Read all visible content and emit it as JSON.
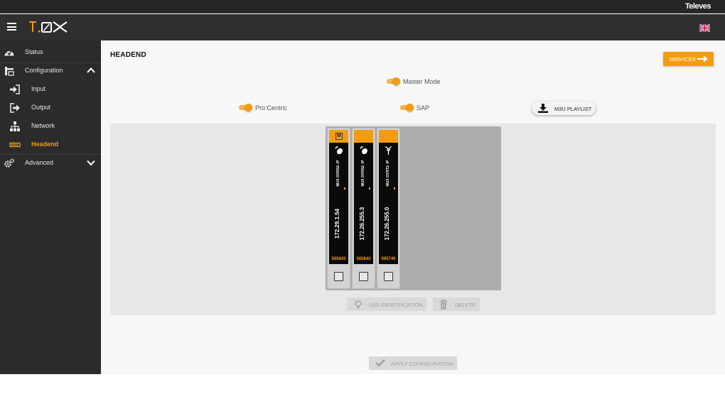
{
  "header": {
    "brand": "Televes",
    "logo_text": "T.OX",
    "language_icon": "uk-flag-icon"
  },
  "sidebar": {
    "items": [
      {
        "label": "Status",
        "icon": "dashboard-icon",
        "active": false
      },
      {
        "label": "Configuration",
        "icon": "configuration-icon",
        "expanded": true
      },
      {
        "label": "Input",
        "icon": "sign-in-icon",
        "active": false
      },
      {
        "label": "Output",
        "icon": "sign-out-icon",
        "active": false
      },
      {
        "label": "Network",
        "icon": "network-icon",
        "active": false
      },
      {
        "label": "Headend",
        "icon": "headend-icon",
        "active": true
      },
      {
        "label": "Advanced",
        "icon": "cogs-icon",
        "expanded": false
      }
    ]
  },
  "main": {
    "title": "HEADEND",
    "services_label": "SERVICES",
    "master_mode": {
      "label": "Master Mode",
      "on": true
    },
    "pro_centric": {
      "label": "Pro:Centric",
      "on": true
    },
    "sap": {
      "label": "SAP",
      "on": true
    },
    "m3u_label": "M3U PLAYLIST",
    "led_label": "LED IDENTIFICATION",
    "delete_label": "DELETE",
    "apply_label": "APPLY CONFIGURATION",
    "modules": [
      {
        "badge": "M",
        "icon": "satellite-dish-icon",
        "model": "MUX OVRS2- IP",
        "ip": "172.29.1.54",
        "serial": "565843"
      },
      {
        "badge": "",
        "icon": "satellite-dish-icon",
        "model": "MUX OVRS2- IP",
        "ip": "172.26.255.3",
        "serial": "565843"
      },
      {
        "badge": "",
        "icon": "antenna-icon",
        "model": "MUX OVRT2- IP",
        "ip": "172.26.255.0",
        "serial": "565740"
      }
    ]
  },
  "colors": {
    "accent": "#f39c12",
    "sidebar_bg": "#2b2b2b",
    "header_bg": "#2f2f2f"
  }
}
